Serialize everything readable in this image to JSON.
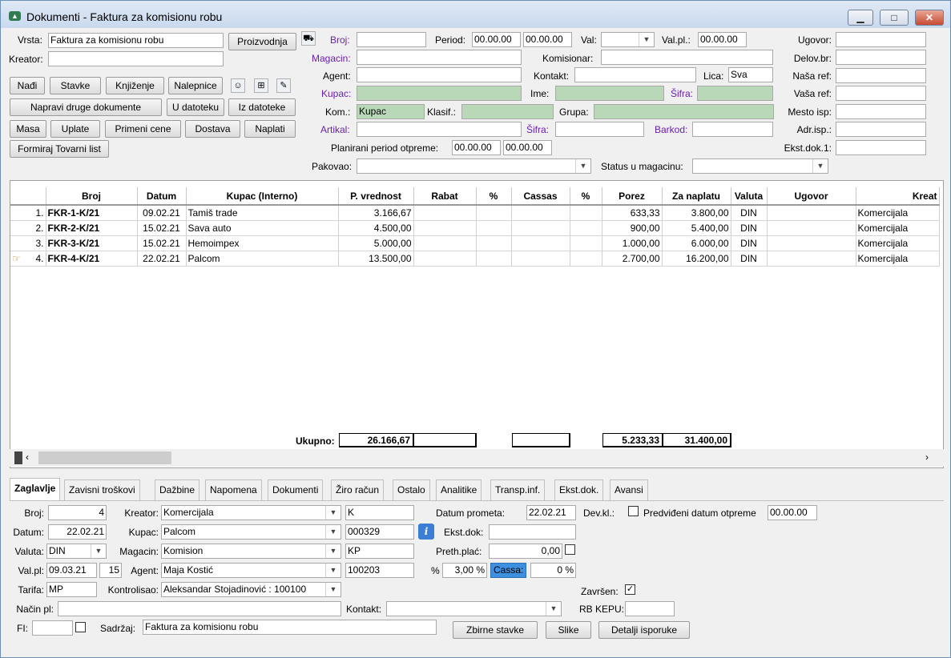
{
  "window": {
    "title": "Dokumenti - Faktura za komisionu robu",
    "min_glyph": "▁",
    "max_glyph": "□",
    "close_glyph": "✕"
  },
  "top": {
    "vrsta_label": "Vrsta:",
    "vrsta_value": "Faktura za komisionu robu",
    "proizvodnja": "Proizvodnja",
    "kreator_label": "Kreator:",
    "kreator_value": "",
    "broj_label": "Broj:",
    "period_label": "Period:",
    "period_from": "00.00.00",
    "period_to": "00.00.00",
    "val_label": "Val:",
    "valpl_label": "Val.pl.:",
    "valpl_value": "00.00.00",
    "ugovor_label": "Ugovor:",
    "magacin_label": "Magacin:",
    "komisionar_label": "Komisionar:",
    "delovbr_label": "Delov.br:",
    "agent_label": "Agent:",
    "kontakt_label": "Kontakt:",
    "lica_label": "Lica:",
    "lica_value": "Sva",
    "nasaref_label": "Naša ref:",
    "kupac_label": "Kupac:",
    "ime_label": "Ime:",
    "sifra_label": "Šifra:",
    "vasaref_label": "Vaša ref:",
    "kom_label": "Kom.:",
    "kom_value": "Kupac",
    "klasif_label": "Klasif.:",
    "grupa_label": "Grupa:",
    "mestoisp_label": "Mesto isp:",
    "artikal_label": "Artikal:",
    "sifra2_label": "Šifra:",
    "barkod_label": "Barkod:",
    "adrisp_label": "Adr.isp.:",
    "planirani_label": "Planirani period otpreme:",
    "plan_from": "00.00.00",
    "plan_to": "00.00.00",
    "ekstdok_label": "Ekst.dok.1:",
    "pakovao_label": "Pakovao:",
    "status_label": "Status u magacinu:"
  },
  "buttons": {
    "nadji": "Nađi",
    "stavke": "Stavke",
    "knjizenje": "Knjiženje",
    "nalepnice": "Nalepnice",
    "napravi": "Napravi druge dokumente",
    "udatoteku": "U datoteku",
    "izdatoteke": "Iz datoteke",
    "masa": "Masa",
    "uplate": "Uplate",
    "primeni": "Primeni cene",
    "dostava": "Dostava",
    "naplati": "Naplati",
    "formiraj": "Formiraj Tovarni list"
  },
  "grid": {
    "columns": [
      "",
      "Broj",
      "Datum",
      "Kupac (Interno)",
      "P. vrednost",
      "Rabat",
      "%",
      "Cassas",
      "%",
      "Porez",
      "Za naplatu",
      "Valuta",
      "Ugovor",
      "Kreat"
    ],
    "rows": [
      {
        "no": "1.",
        "broj": "FKR-1-K/21",
        "datum": "09.02.21",
        "kupac": "Tamiš trade",
        "pvred": "3.166,67",
        "rabat": "",
        "p1": "",
        "cassas": "",
        "p2": "",
        "porez": "633,33",
        "zanapl": "3.800,00",
        "valuta": "DIN",
        "ugovor": "",
        "kreator": "Komercijala"
      },
      {
        "no": "2.",
        "broj": "FKR-2-K/21",
        "datum": "15.02.21",
        "kupac": "Sava auto",
        "pvred": "4.500,00",
        "rabat": "",
        "p1": "",
        "cassas": "",
        "p2": "",
        "porez": "900,00",
        "zanapl": "5.400,00",
        "valuta": "DIN",
        "ugovor": "",
        "kreator": "Komercijala"
      },
      {
        "no": "3.",
        "broj": "FKR-3-K/21",
        "datum": "15.02.21",
        "kupac": "Hemoimpex",
        "pvred": "5.000,00",
        "rabat": "",
        "p1": "",
        "cassas": "",
        "p2": "",
        "porez": "1.000,00",
        "zanapl": "6.000,00",
        "valuta": "DIN",
        "ugovor": "",
        "kreator": "Komercijala"
      },
      {
        "no": "4.",
        "broj": "FKR-4-K/21",
        "datum": "22.02.21",
        "kupac": "Palcom",
        "pvred": "13.500,00",
        "rabat": "",
        "p1": "",
        "cassas": "",
        "p2": "",
        "porez": "2.700,00",
        "zanapl": "16.200,00",
        "valuta": "DIN",
        "ugovor": "",
        "kreator": "Komercijala"
      }
    ],
    "totals": {
      "label": "Ukupno:",
      "pvred": "26.166,67",
      "rabat": "",
      "cassas": "",
      "porez": "5.233,33",
      "zanapl": "31.400,00"
    }
  },
  "tabs": [
    "Zaglavlje",
    "Zavisni troškovi",
    "Dažbine",
    "Napomena",
    "Dokumenti",
    "Žiro račun",
    "Ostalo",
    "Analitike",
    "Transp.inf.",
    "Ekst.dok.",
    "Avansi"
  ],
  "detail": {
    "broj_label": "Broj:",
    "broj": "4",
    "kreator_label": "Kreator:",
    "kreator": "Komercijala",
    "kreator_code": "K",
    "datprom_label": "Datum prometa:",
    "datprom": "22.02.21",
    "devkl_label": "Dev.kl.:",
    "predv_label": "Predviđeni datum otpreme",
    "predv": "00.00.00",
    "datum_label": "Datum:",
    "datum": "22.02.21",
    "kupac_label": "Kupac:",
    "kupac": "Palcom",
    "kupac_code": "000329",
    "info_glyph": "i",
    "ekstdok_label": "Ekst.dok:",
    "valuta_label": "Valuta:",
    "valuta": "DIN",
    "magacin_label": "Magacin:",
    "magacin": "Komision",
    "magacin_code": "KP",
    "prethplac_label": "Preth.plać:",
    "prethplac": "0,00",
    "valpl_label": "Val.pl:",
    "valpl": "09.03.21",
    "valpl_days": "15",
    "agent_label": "Agent:",
    "agent": "Maja Kostić",
    "agent_code": "100203",
    "pct_label": "%",
    "pct": "3,00 %",
    "cassa_label": "Cassa:",
    "cassa": "0 %",
    "tarifa_label": "Tarifa:",
    "tarifa": "MP",
    "kontrolisao_label": "Kontrolisao:",
    "kontrolisao": "Aleksandar Stojadinović : 100100",
    "zavrsen_label": "Završen:",
    "nacinpl_label": "Način pl:",
    "kontakt_label": "Kontakt:",
    "rbkepu_label": "RB KEPU:",
    "fi_label": "FI:",
    "sadrzaj_label": "Sadržaj:",
    "sadrzaj": "Faktura za komisionu robu",
    "zbirne": "Zbirne stavke",
    "slike": "Slike",
    "detalji": "Detalji isporuke"
  },
  "colors": {
    "accent": "#3d8fe0",
    "green_field": "#b8d8b8",
    "purple_label": "#6a1fb0"
  }
}
